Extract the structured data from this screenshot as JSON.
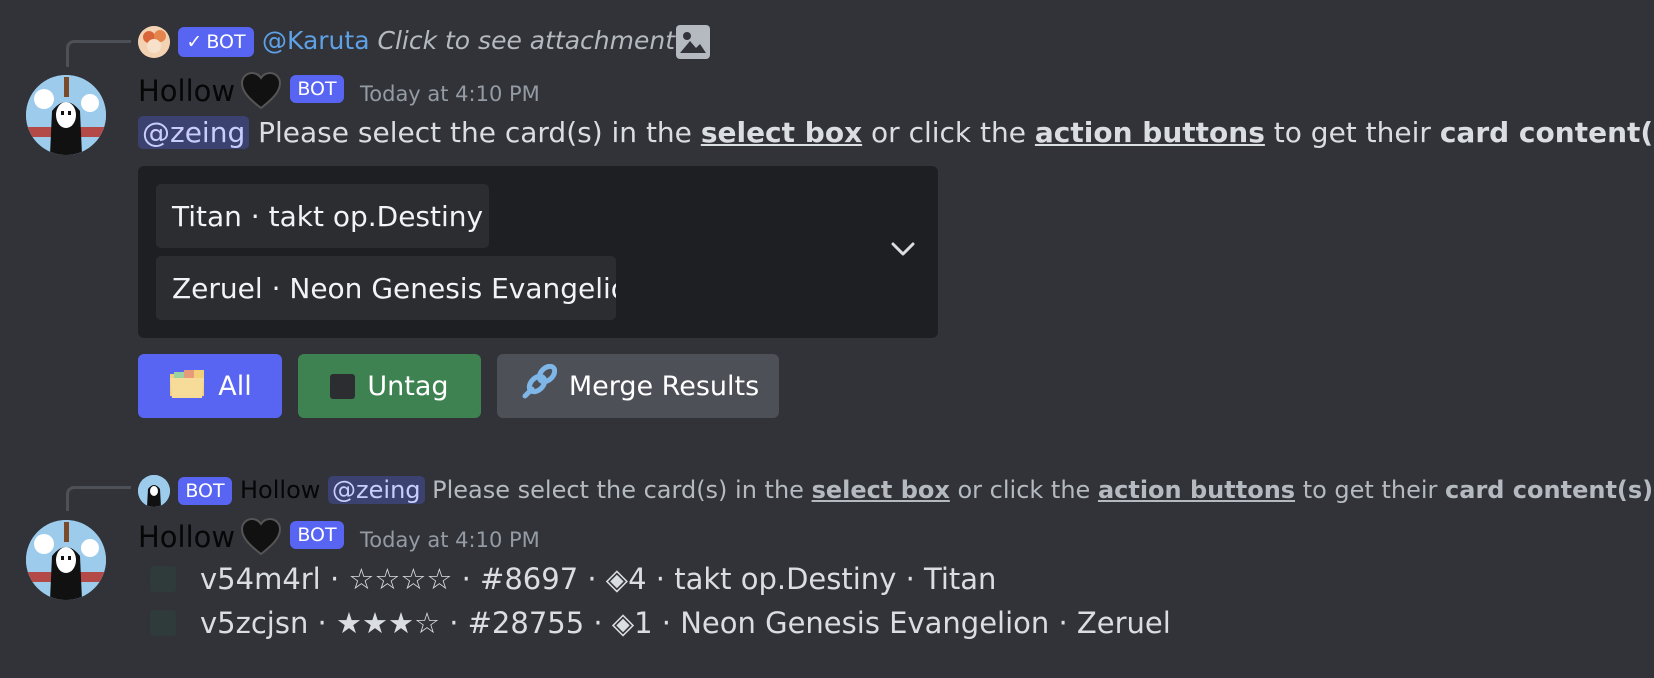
{
  "reply1": {
    "bot_tag": "BOT",
    "mention": "@Karuta",
    "text": "Click to see attachment"
  },
  "message1": {
    "username": "Hollow",
    "bot_tag": "BOT",
    "timestamp": "Today at 4:10 PM",
    "mention": "@zeing",
    "text_part1": " Please select the card(s) in the ",
    "link1": "select box",
    "text_part2": " or click the ",
    "link2": "action buttons",
    "text_part3": " to get their ",
    "bold": "card content(s)",
    "text_part4": "."
  },
  "select": {
    "options": [
      "Titan · takt op.Destiny",
      "Zeruel · Neon Genesis Evangelion"
    ]
  },
  "buttons": {
    "all": "All",
    "untag": "Untag",
    "merge": "Merge Results"
  },
  "reply2": {
    "bot_tag": "BOT",
    "username": "Hollow",
    "mention": "@zeing",
    "text_part1": " Please select the card(s) in the ",
    "link1": "select box",
    "text_part2": " or click the ",
    "link2": "action buttons",
    "text_part3": " to get their ",
    "bold": "card content(s)",
    "text_part4": "."
  },
  "message2": {
    "username": "Hollow",
    "bot_tag": "BOT",
    "timestamp": "Today at 4:10 PM",
    "lines": [
      "v54m4rl · ☆☆☆☆ · #8697  · ◈4 · takt op.Destiny · Titan",
      "v5zcjsn · ★★★☆ · #28755 · ◈1 · Neon Genesis Evangelion · Zeruel"
    ]
  },
  "colors": {
    "background": "#313338",
    "blurple": "#5865f2",
    "green": "#3e8251",
    "grey_button": "#4e5058"
  }
}
